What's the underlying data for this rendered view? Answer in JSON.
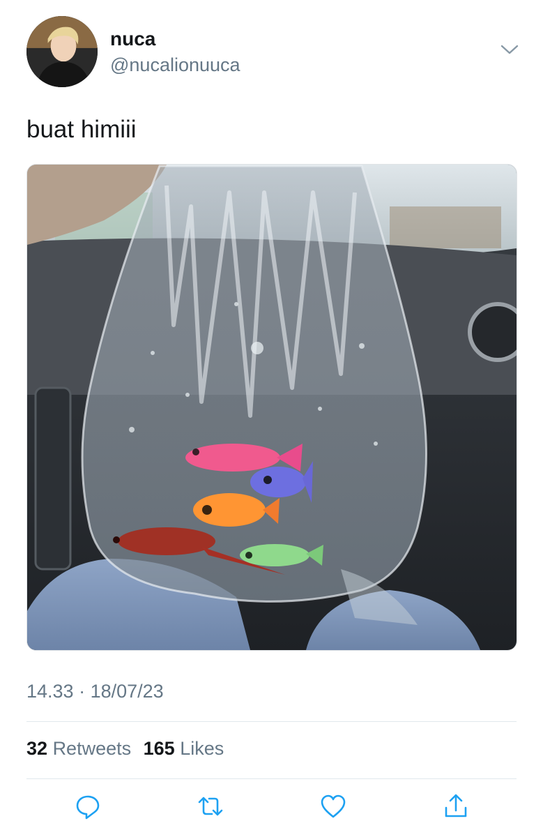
{
  "author": {
    "name": "nuca",
    "handle": "@nucalionuuca"
  },
  "tweet": {
    "text": "buat himiii",
    "time": "14.33",
    "separator": " · ",
    "date": "18/07/23"
  },
  "stats": {
    "retweets_count": "32",
    "retweets_label": "Retweets",
    "likes_count": "165",
    "likes_label": "Likes"
  },
  "icons": {
    "menu": "chevron-down-icon",
    "reply": "reply-icon",
    "retweet": "retweet-icon",
    "like": "heart-icon",
    "share": "share-icon"
  },
  "colors": {
    "text": "#14171a",
    "secondary": "#657786",
    "divider": "#e1e8ed",
    "icon": "#1da1f2"
  }
}
